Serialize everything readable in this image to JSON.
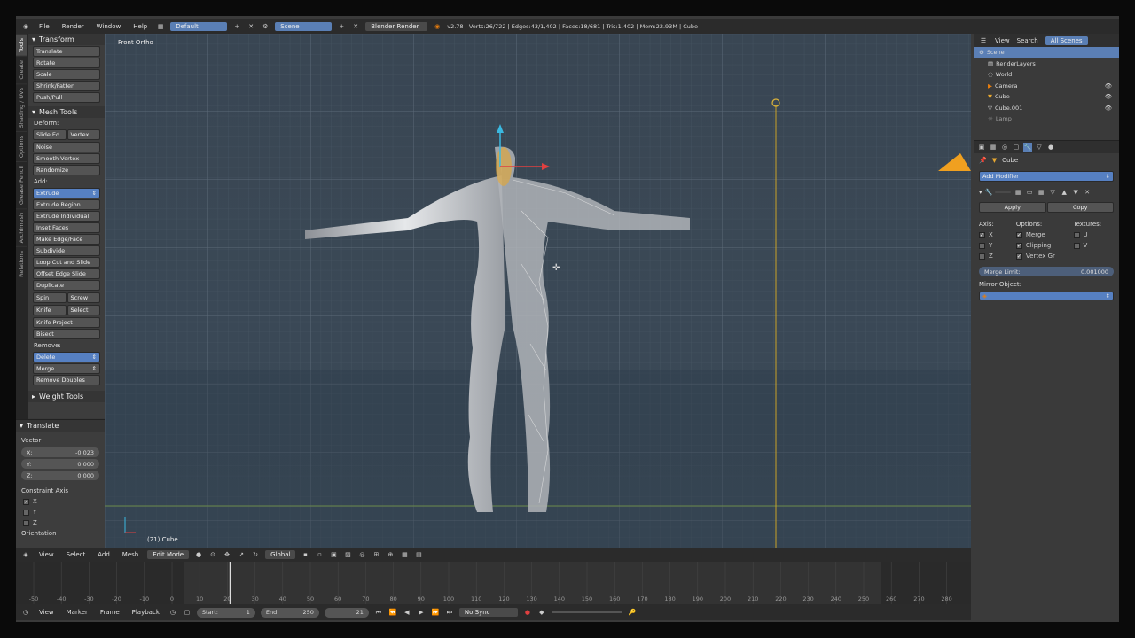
{
  "topbar": {
    "menus": [
      "File",
      "Render",
      "Window",
      "Help"
    ],
    "layout": "Default",
    "scene": "Scene",
    "engine": "Blender Render",
    "stats": "v2.78 | Verts:26/722 | Edges:43/1,402 | Faces:18/681 | Tris:1,402 | Mem:22.93M | Cube"
  },
  "vtabs": [
    "Tools",
    "Create",
    "Shading / UVs",
    "Options",
    "Grease Pencil",
    "Archimesh",
    "Relations"
  ],
  "tools": {
    "transform_title": "Transform",
    "transform": [
      "Translate",
      "Rotate",
      "Scale",
      "Shrink/Fatten",
      "Push/Pull"
    ],
    "mesh_title": "Mesh Tools",
    "deform_label": "Deform:",
    "slide": [
      "Slide Ed",
      "Vertex"
    ],
    "deform": [
      "Noise",
      "Smooth Vertex",
      "Randomize"
    ],
    "add_label": "Add:",
    "add": [
      "Extrude",
      "Extrude Region",
      "Extrude Individual",
      "Inset Faces",
      "Make Edge/Face",
      "Subdivide",
      "Loop Cut and Slide",
      "Offset Edge Slide",
      "Duplicate"
    ],
    "spin": [
      "Spin",
      "Screw"
    ],
    "knife": [
      "Knife",
      "Select"
    ],
    "add2": [
      "Knife Project",
      "Bisect"
    ],
    "remove_label": "Remove:",
    "remove": [
      "Delete",
      "Merge",
      "Remove Doubles"
    ],
    "weight_title": "Weight Tools"
  },
  "redo": {
    "title": "Translate",
    "vector_label": "Vector",
    "x_label": "X:",
    "x": "-0.023",
    "y_label": "Y:",
    "y": "0.000",
    "z_label": "Z:",
    "z": "0.000",
    "constraint_label": "Constraint Axis",
    "axes": [
      "X",
      "Y",
      "Z"
    ],
    "orientation_label": "Orientation"
  },
  "viewport": {
    "title": "Front Ortho",
    "object_label": "(21) Cube"
  },
  "outliner": {
    "tabs": [
      "View",
      "Search",
      "All Scenes"
    ],
    "items": [
      "Scene",
      "RenderLayers",
      "World",
      "Camera",
      "Cube",
      "Cube.001",
      "Lamp"
    ]
  },
  "props": {
    "object_name": "Cube",
    "add_modifier": "Add Modifier",
    "apply": "Apply",
    "copy": "Copy",
    "axis_label": "Axis:",
    "options_label": "Options:",
    "textures_label": "Textures:",
    "axes": [
      "X",
      "Y",
      "Z"
    ],
    "options": [
      "Merge",
      "Clipping",
      "Vertex Gr"
    ],
    "textures": [
      "U",
      "V"
    ],
    "merge_limit_label": "Merge Limit:",
    "merge_limit": "0.001000",
    "mirror_object_label": "Mirror Object:"
  },
  "headerbar": {
    "menus": [
      "View",
      "Select",
      "Add",
      "Mesh"
    ],
    "mode": "Edit Mode",
    "orientation": "Global"
  },
  "timeline": {
    "ticks": [
      "-50",
      "-40",
      "-30",
      "-20",
      "-10",
      "0",
      "10",
      "20",
      "30",
      "40",
      "50",
      "60",
      "70",
      "80",
      "90",
      "100",
      "110",
      "120",
      "130",
      "140",
      "150",
      "160",
      "170",
      "180",
      "190",
      "200",
      "210",
      "220",
      "230",
      "240",
      "250",
      "260",
      "270",
      "280"
    ],
    "current_frame": 21
  },
  "tlbar": {
    "menus": [
      "View",
      "Marker",
      "Frame",
      "Playback"
    ],
    "start_label": "Start:",
    "start": "1",
    "end_label": "End:",
    "end": "250",
    "current": "21",
    "sync": "No Sync"
  }
}
